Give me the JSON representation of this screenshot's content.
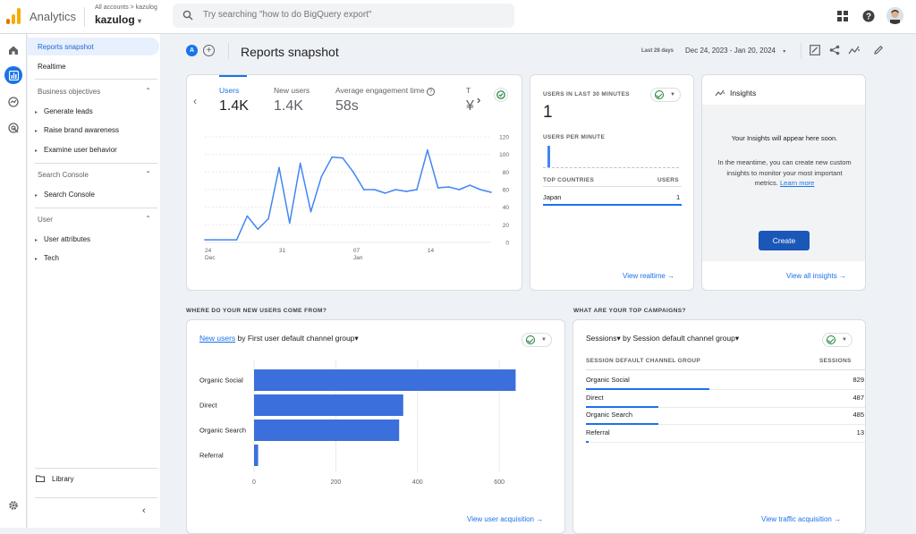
{
  "app": {
    "name": "Analytics",
    "crumb": "All accounts > kazulog",
    "account": "kazulog",
    "account_caret": "▾"
  },
  "search": {
    "placeholder": "Try searching \"how to do BigQuery export\""
  },
  "sidenav": {
    "items": [
      {
        "label": "Reports snapshot",
        "active": true
      },
      {
        "label": "Realtime",
        "active": false
      }
    ],
    "sections": [
      {
        "title": "Business objectives",
        "items": [
          "Generate leads",
          "Raise brand awareness",
          "Examine user behavior"
        ]
      },
      {
        "title": "Search Console",
        "items": [
          "Search Console"
        ]
      },
      {
        "title": "User",
        "items": [
          "User attributes",
          "Tech"
        ]
      }
    ],
    "library": "Library"
  },
  "header": {
    "avatar_letter": "A",
    "add": "+",
    "title": "Reports snapshot",
    "date_label": "Last 28 days",
    "date_range": "Dec 24, 2023 - Jan 20, 2024"
  },
  "overview": {
    "metrics": [
      {
        "label": "Users",
        "value": "1.4K"
      },
      {
        "label": "New users",
        "value": "1.4K"
      },
      {
        "label": "Average engagement time",
        "value": "58s"
      },
      {
        "label": "T",
        "value": "¥"
      }
    ],
    "chart_data": {
      "type": "line",
      "x": [
        24,
        25,
        26,
        27,
        28,
        29,
        30,
        31,
        1,
        2,
        3,
        4,
        5,
        6,
        7,
        8,
        9,
        10,
        11,
        12,
        13,
        14,
        15,
        16,
        17,
        18,
        19,
        20
      ],
      "values": [
        3,
        3,
        3,
        3,
        30,
        15,
        27,
        85,
        22,
        90,
        35,
        75,
        97,
        96,
        80,
        60,
        60,
        56,
        60,
        58,
        60,
        105,
        62,
        63,
        60,
        65,
        60,
        57
      ],
      "ylim": [
        0,
        120
      ],
      "y_ticks": [
        "120",
        "100",
        "80",
        "60",
        "40",
        "20",
        "0"
      ],
      "x_ticks": [
        {
          "label": "24",
          "sub": "Dec"
        },
        {
          "label": "31",
          "sub": ""
        },
        {
          "label": "07",
          "sub": "Jan"
        },
        {
          "label": "14",
          "sub": ""
        }
      ],
      "series_color": "#4285f4"
    }
  },
  "realtime": {
    "caption": "USERS IN LAST 30 MINUTES",
    "value": "1",
    "per_minute": "USERS PER MINUTE",
    "col1": "TOP COUNTRIES",
    "col2": "USERS",
    "rows": [
      {
        "country": "Japan",
        "users": "1"
      }
    ],
    "link": "View realtime →"
  },
  "insights": {
    "title": "Insights",
    "line1": "Your Insights will appear here soon.",
    "line2": "In the meantime, you can create new custom insights to monitor your most important metrics.",
    "learn_more": "Learn more",
    "button": "Create",
    "link": "View all insights →"
  },
  "acquisition": {
    "section_title": "WHERE DO YOUR NEW USERS COME FROM?",
    "metric": "New users",
    "by": " by First user default channel group▾",
    "chart_data": {
      "type": "bar",
      "categories": [
        "Organic Social",
        "Direct",
        "Organic Search",
        "Referral"
      ],
      "values": [
        640,
        365,
        355,
        10
      ],
      "xlim": [
        0,
        650
      ],
      "x_ticks": [
        "0",
        "200",
        "400",
        "600"
      ],
      "color": "#3b6fdb"
    },
    "link": "View user acquisition →"
  },
  "campaigns": {
    "section_title": "WHAT ARE YOUR TOP CAMPAIGNS?",
    "metric": "Sessions▾",
    "by": " by Session default channel group▾",
    "col1": "SESSION DEFAULT CHANNEL GROUP",
    "col2": "SESSIONS",
    "rows": [
      {
        "name": "Organic Social",
        "value": "829",
        "frac": 0.44
      },
      {
        "name": "Direct",
        "value": "487",
        "frac": 0.26
      },
      {
        "name": "Organic Search",
        "value": "485",
        "frac": 0.26
      },
      {
        "name": "Referral",
        "value": "13",
        "frac": 0.01
      }
    ],
    "link": "View traffic acquisition →"
  }
}
